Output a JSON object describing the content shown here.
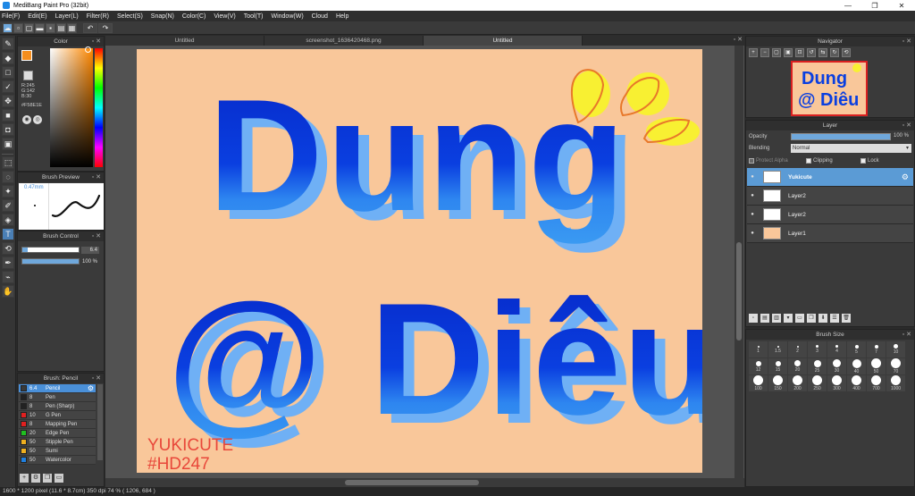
{
  "window": {
    "title": "MediBang Paint Pro (32bit)",
    "controls": [
      "—",
      "❐",
      "✕"
    ]
  },
  "menu": [
    "File(F)",
    "Edit(E)",
    "Layer(L)",
    "Filter(R)",
    "Select(S)",
    "Snap(N)",
    "Color(C)",
    "View(V)",
    "Tool(T)",
    "Window(W)",
    "Cloud",
    "Help"
  ],
  "tabs": [
    "Untitled",
    "screenshot_1636420468.png",
    "Untitled"
  ],
  "active_tab_index": 2,
  "color": {
    "header": "Color",
    "foreground": "#F58E1E",
    "r": "R:245",
    "g": "G:142",
    "b": "B:30",
    "hex": "#F58E1E"
  },
  "brush_preview": {
    "header": "Brush Preview",
    "size_label": "0.47mm"
  },
  "brush_control": {
    "header": "Brush Control",
    "size_value": "6.4",
    "size_fraction": 0.09,
    "opacity_value": "100 %",
    "opacity_fraction": 1.0
  },
  "brush_list": {
    "header": "Brush: Pencil",
    "items": [
      {
        "size": "6.4",
        "name": "Pencil",
        "color": "#3a3a3a",
        "selected": true
      },
      {
        "size": "8",
        "name": "Pen",
        "color": "#222222"
      },
      {
        "size": "8",
        "name": "Pen (Sharp)",
        "color": "#222222"
      },
      {
        "size": "10",
        "name": "G Pen",
        "color": "#e02020"
      },
      {
        "size": "8",
        "name": "Mapping Pen",
        "color": "#e02020"
      },
      {
        "size": "20",
        "name": "Edge Pen",
        "color": "#20c020"
      },
      {
        "size": "50",
        "name": "Stipple Pen",
        "color": "#f0b020"
      },
      {
        "size": "50",
        "name": "Sumi",
        "color": "#f0b020"
      },
      {
        "size": "50",
        "name": "Watercolor",
        "color": "#2080e0"
      }
    ]
  },
  "canvas": {
    "background": "#F9C79A",
    "line1": "Dung",
    "line2": "@ Diêu",
    "signature1": "YUKICUTE",
    "signature2": "#HD247"
  },
  "navigator": {
    "header": "Navigator",
    "thumb_line1": "Dung",
    "thumb_line2": "@ Diêu"
  },
  "layer": {
    "header": "Layer",
    "opacity_label": "Opacity",
    "opacity_value": "100 %",
    "blending_label": "Blending",
    "blending_value": "Normal",
    "protect_alpha": "Protect Alpha",
    "clipping": "Clipping",
    "lock": "Lock",
    "layers": [
      {
        "name": "Yukicute",
        "selected": true
      },
      {
        "name": "Layer2"
      },
      {
        "name": "Layer2"
      },
      {
        "name": "Layer1",
        "thumb": "#F9C79A"
      }
    ]
  },
  "brush_size": {
    "header": "Brush Size",
    "sizes": [
      "1",
      "1.5",
      "2",
      "3",
      "4",
      "5",
      "7",
      "10",
      "12",
      "15",
      "20",
      "25",
      "30",
      "40",
      "50",
      "70",
      "100",
      "150",
      "200",
      "250",
      "300",
      "400",
      "700",
      "1000"
    ]
  },
  "status": {
    "text": "1600 * 1200 pixel  (11.6 * 8.7cm)  350 dpi  74 %  ( 1206, 684 )"
  }
}
